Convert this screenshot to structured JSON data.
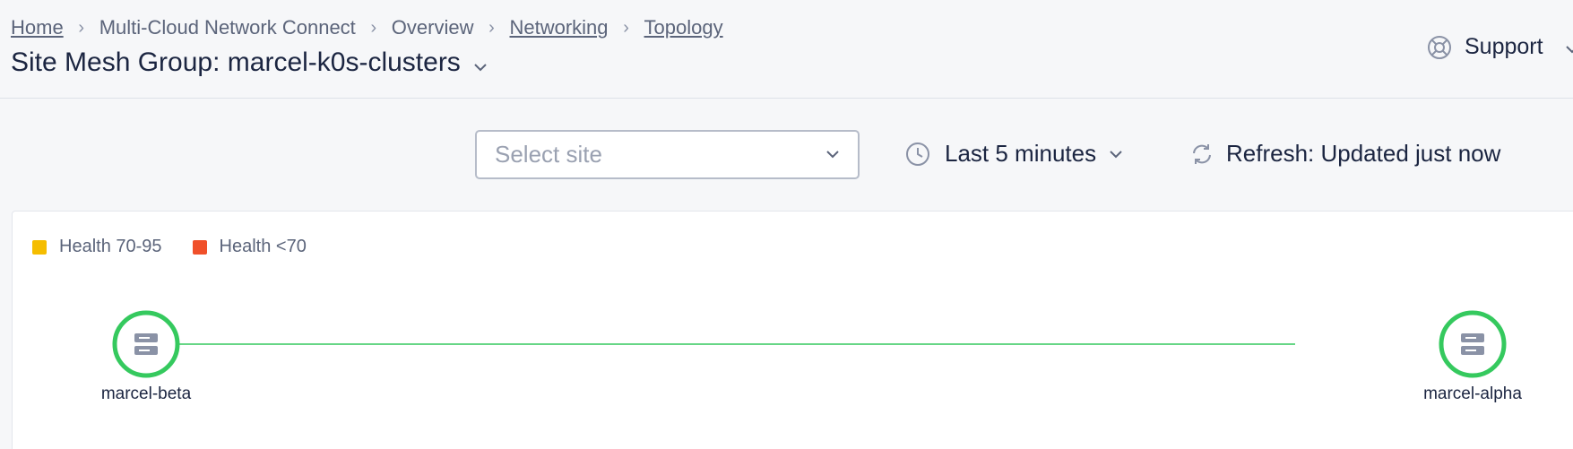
{
  "breadcrumb": {
    "home": "Home",
    "product": "Multi-Cloud Network Connect",
    "overview": "Overview",
    "networking": "Networking",
    "topology": "Topology"
  },
  "page": {
    "title": "Site Mesh Group: marcel-k0s-clusters"
  },
  "support": {
    "label": "Support"
  },
  "toolbar": {
    "site_select_placeholder": "Select site",
    "time_range": "Last 5 minutes",
    "refresh": "Refresh: Updated just now"
  },
  "legend": {
    "items": [
      {
        "label": "Health 70-95",
        "color": "#f5bd00"
      },
      {
        "label": "Health <70",
        "color": "#f0502a"
      }
    ]
  },
  "topology": {
    "nodes": [
      {
        "name": "marcel-beta",
        "status_color": "#35c95e",
        "icon": "server-icon"
      },
      {
        "name": "marcel-alpha",
        "status_color": "#35c95e",
        "icon": "server-icon"
      }
    ],
    "link_color": "#35c95e"
  },
  "colors": {
    "text_primary": "#1b2541",
    "text_secondary": "#5b647a",
    "icon_gray": "#8a92a6"
  }
}
